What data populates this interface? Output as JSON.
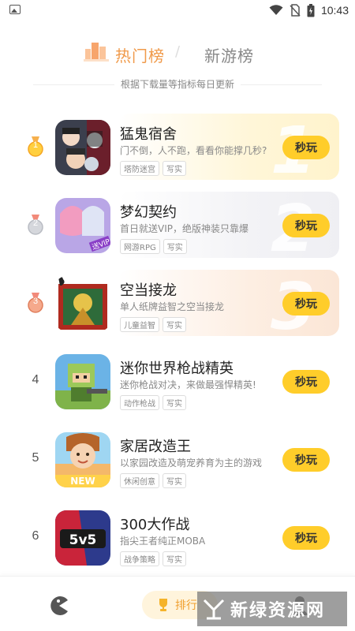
{
  "status_bar": {
    "time": "10:43"
  },
  "tabs": {
    "hot": "热门榜",
    "separator": "/",
    "new": "新游榜"
  },
  "subtitle": "根据下载量等指标每日更新",
  "play_label": "秒玩",
  "games": [
    {
      "rank": "1",
      "name": "猛鬼宿舍",
      "desc": "门不倒，人不跑，看看你能撑几秒?",
      "tags": [
        "塔防迷宫",
        "写实"
      ],
      "icon": "ghost-dorm-icon"
    },
    {
      "rank": "2",
      "name": "梦幻契约",
      "desc": "首日就送VIP，绝版神装只靠爆",
      "tags": [
        "网游RPG",
        "写实"
      ],
      "icon": "fantasy-contract-icon"
    },
    {
      "rank": "3",
      "name": "空当接龙",
      "desc": "单人纸牌益智之空当接龙",
      "tags": [
        "儿童益智",
        "写实"
      ],
      "icon": "freecell-icon"
    },
    {
      "rank": "4",
      "name": "迷你世界枪战精英",
      "desc": "迷你枪战对决，来做最强悍精英!",
      "tags": [
        "动作枪战",
        "写实"
      ],
      "icon": "mini-world-gun-icon"
    },
    {
      "rank": "5",
      "name": "家居改造王",
      "desc": "以家园改造及萌宠养育为主的游戏",
      "tags": [
        "休闲创意",
        "写实"
      ],
      "icon": "home-makeover-icon",
      "badge": "NEW"
    },
    {
      "rank": "6",
      "name": "300大作战",
      "desc": "指尖王者纯正MOBA",
      "tags": [
        "战争策略",
        "写实"
      ],
      "icon": "300-battle-icon",
      "badge": "5v5"
    }
  ],
  "bottom_nav": {
    "rank_label": "排行"
  },
  "watermark": {
    "text": "新绿资源网"
  },
  "colors": {
    "accent": "#f09a4a",
    "button": "#ffcd2a"
  }
}
